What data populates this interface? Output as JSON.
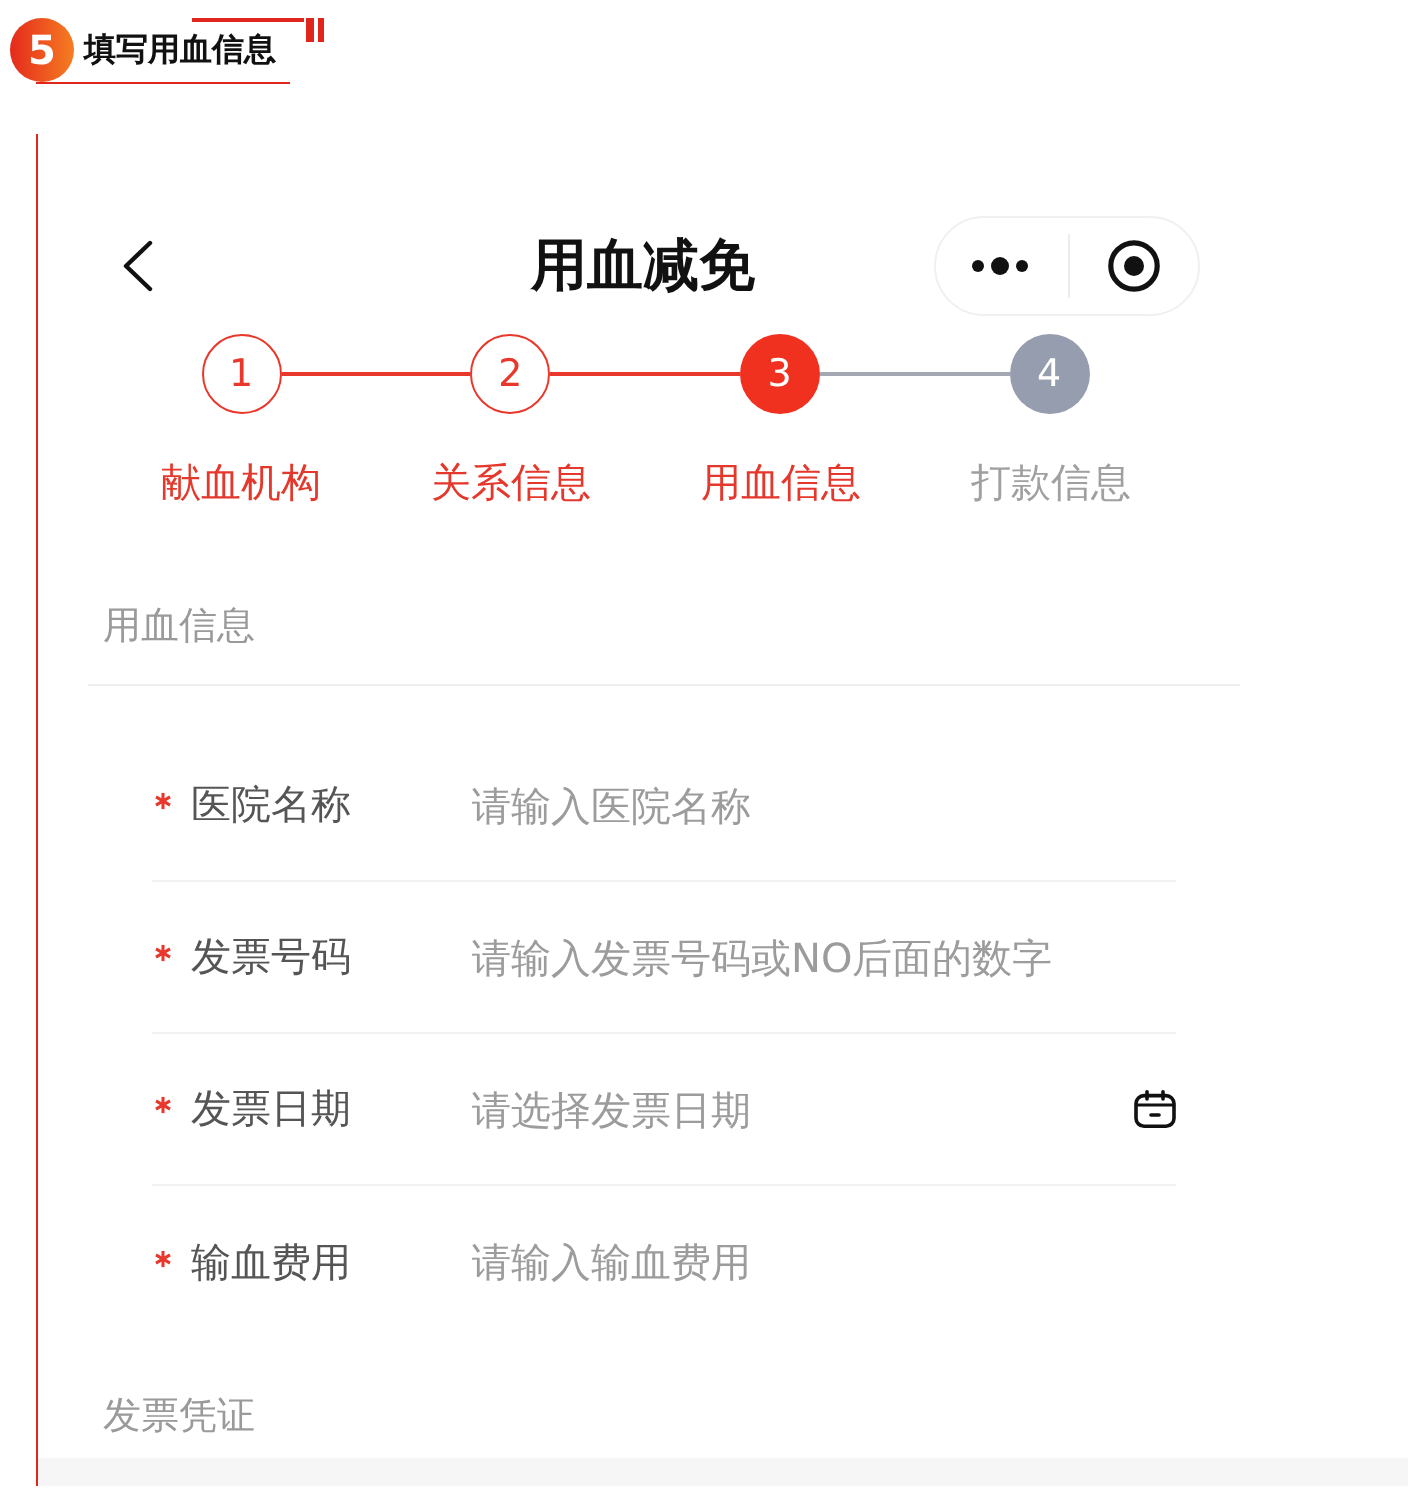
{
  "header": {
    "badge": "5",
    "title": "填写用血信息"
  },
  "nav": {
    "title": "用血减免"
  },
  "steps": [
    {
      "number": "1",
      "label": "献血机构",
      "completed": true,
      "selected": false
    },
    {
      "number": "2",
      "label": "关系信息",
      "completed": true,
      "selected": false
    },
    {
      "number": "3",
      "label": "用血信息",
      "completed": false,
      "selected": true
    },
    {
      "number": "4",
      "label": "打款信息",
      "completed": false,
      "selected": false
    }
  ],
  "sections": [
    {
      "title": "用血信息",
      "fields": [
        {
          "label": "医院名称",
          "required": true,
          "kind": "text",
          "placeholder": "请输入医院名称"
        },
        {
          "label": "发票号码",
          "required": true,
          "kind": "text",
          "placeholder": "请输入发票号码或NO后面的数字"
        },
        {
          "label": "发票日期",
          "required": true,
          "kind": "date",
          "placeholder": "请选择发票日期"
        },
        {
          "label": "输血费用",
          "required": true,
          "kind": "text",
          "placeholder": "请输入输血费用"
        }
      ]
    },
    {
      "title": "发票凭证"
    }
  ]
}
